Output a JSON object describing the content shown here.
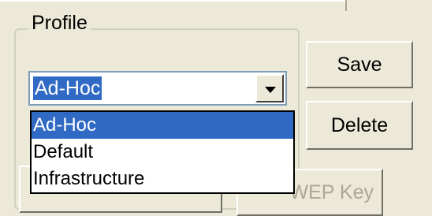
{
  "profile_group": {
    "label": "Profile",
    "combo_value": "Ad-Hoc",
    "options": [
      "Ad-Hoc",
      "Default",
      "Infrastructure"
    ],
    "selected_index": 0
  },
  "buttons": {
    "save": "Save",
    "delete": "Delete",
    "wep_key": "WEP Key"
  },
  "colors": {
    "face": "#ece9d8",
    "selection": "#316ac5",
    "field_border": "#7f9db9",
    "disabled_text": "#aca899"
  },
  "icons": {
    "dropdown_arrow": "chevron-down-icon"
  }
}
